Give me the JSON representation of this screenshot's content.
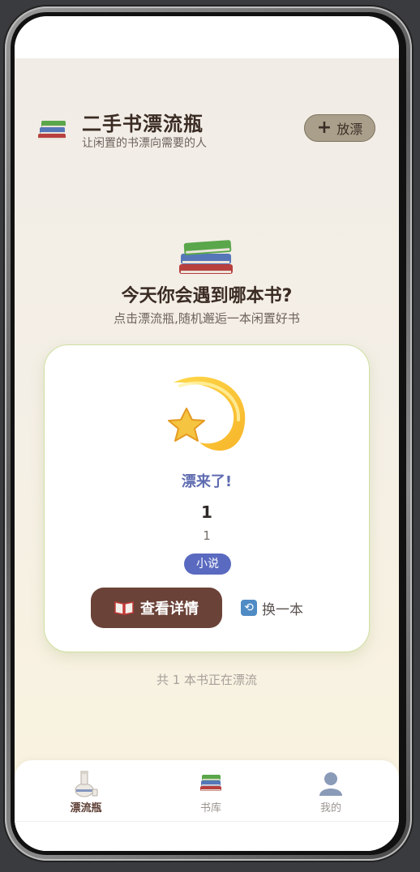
{
  "header": {
    "title": "二手书漂流瓶",
    "subtitle": "让闲置的书漂向需要的人",
    "drop_button_label": "放漂",
    "brand_icon": "books-stack-icon"
  },
  "hero": {
    "icon": "books-stack-icon",
    "title": "今天你会遇到哪本书?",
    "subtitle": "点击漂流瓶,随机邂逅一本闲置好书"
  },
  "card": {
    "icon": "shooting-star-icon",
    "arrived_text": "漂来了!",
    "book_title": "1",
    "book_author": "1",
    "genre_tag": "小说",
    "detail_button_label": "查看详情",
    "detail_button_icon": "open-book-icon",
    "swap_button_label": "换一本",
    "swap_button_icon": "refresh-icon"
  },
  "footer_count": "共 1 本书正在漂流",
  "nav": {
    "items": [
      {
        "label": "漂流瓶",
        "icon": "sake-bottle-icon",
        "active": true
      },
      {
        "label": "书库",
        "icon": "books-stack-icon",
        "active": false
      },
      {
        "label": "我的",
        "icon": "person-silhouette-icon",
        "active": false
      }
    ]
  },
  "colors": {
    "accent_brown": "#6b4238",
    "tag_blue": "#5a6ac0",
    "arrived_blue": "#5e6bb0",
    "card_border": "#cfe0a1",
    "drop_button_bg": "#a99f8a"
  }
}
